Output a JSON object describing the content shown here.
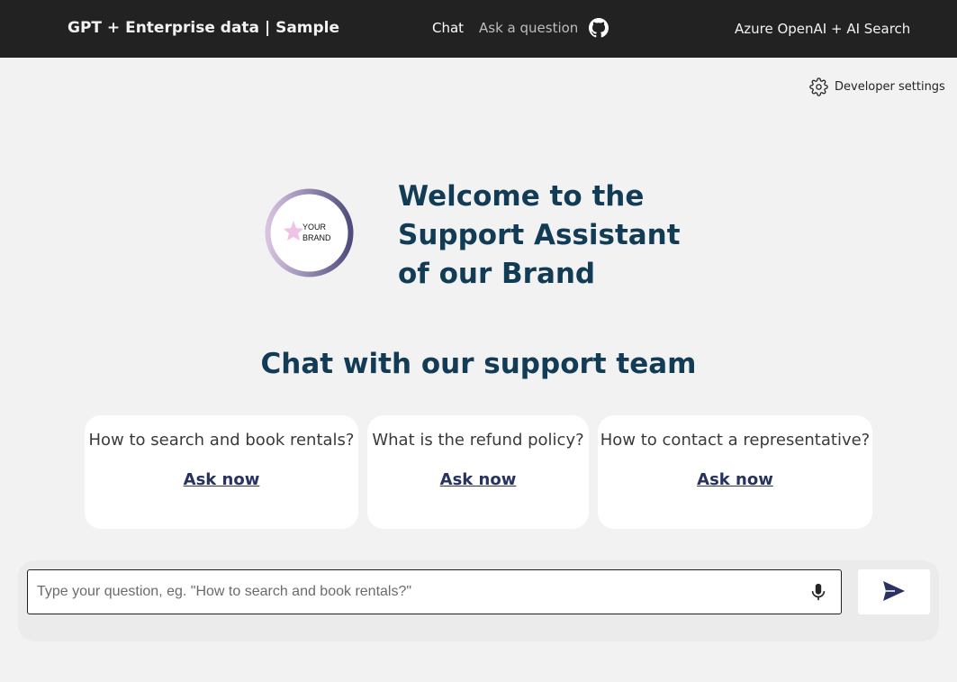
{
  "header": {
    "title": "GPT + Enterprise data | Sample",
    "nav": {
      "chat": "Chat",
      "ask": "Ask a question"
    },
    "github_icon": "github-icon",
    "right_text": "Azure OpenAI + AI Search"
  },
  "dev_settings": {
    "label": "Developer settings",
    "icon": "gear-icon"
  },
  "logo": {
    "line1": "YOUR",
    "line2": "BRAND"
  },
  "welcome": "Welcome to the Support Assistant of our Brand",
  "subtitle": "Chat with our support team",
  "examples": [
    {
      "question": "How to search and book rentals?",
      "action": "Ask now"
    },
    {
      "question": "What is the refund policy?",
      "action": "Ask now"
    },
    {
      "question": "How to contact a representative?",
      "action": "Ask now"
    }
  ],
  "input": {
    "placeholder": "Type your question, eg. \"How to search and book rentals?\"",
    "value": ""
  },
  "colors": {
    "header_bg": "#222222",
    "page_bg": "#f2f2f2",
    "title_text": "#123b55",
    "link": "#27325e"
  }
}
